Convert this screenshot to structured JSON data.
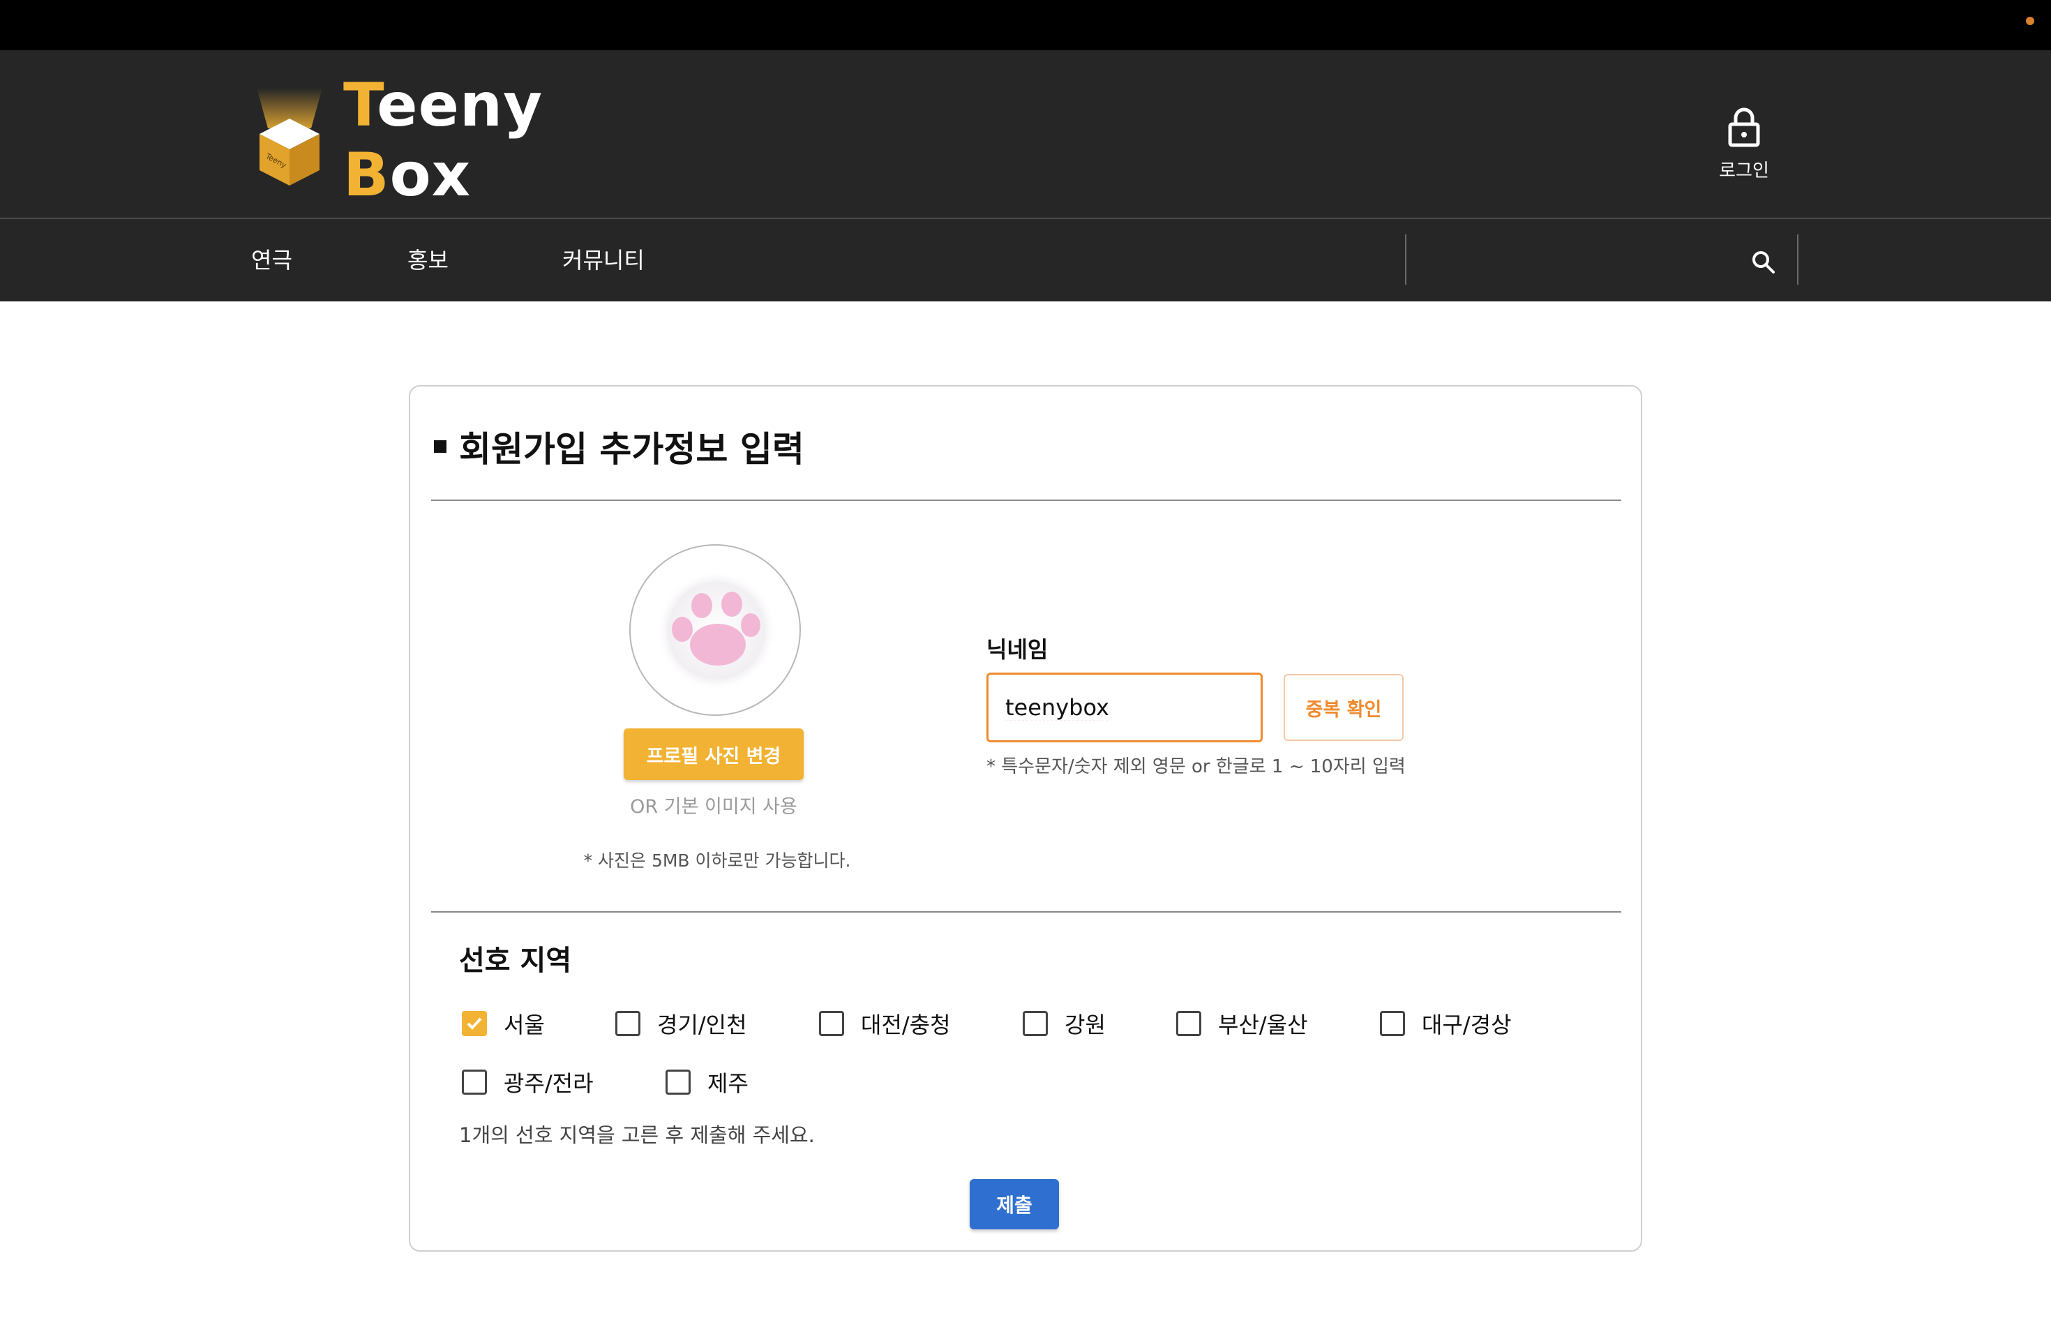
{
  "header": {
    "logo_text_first": "T",
    "logo_text_mid": "eeny ",
    "logo_text_b": "B",
    "logo_text_end": "ox",
    "logo_box_lettering": "Teeny",
    "login_label": "로그인",
    "login_icon": "lock-icon"
  },
  "nav": {
    "items": [
      {
        "label": "연극"
      },
      {
        "label": "홍보"
      },
      {
        "label": "커뮤니티"
      }
    ],
    "search_icon": "search-icon"
  },
  "form": {
    "title": "회원가입 추가정보 입력",
    "profile": {
      "change_button": "프로필 사진 변경",
      "default_option": "OR 기본 이미지 사용",
      "note": "* 사진은 5MB 이하로만 가능합니다."
    },
    "nickname": {
      "label": "닉네임",
      "value": "teenybox",
      "check_button": "중복 확인",
      "note": "* 특수문자/숫자 제외 영문 or 한글로 1 ~ 10자리 입력"
    },
    "region": {
      "title": "선호 지역",
      "options": [
        {
          "label": "서울",
          "checked": true
        },
        {
          "label": "경기/인천",
          "checked": false
        },
        {
          "label": "대전/충청",
          "checked": false
        },
        {
          "label": "강원",
          "checked": false
        },
        {
          "label": "부산/울산",
          "checked": false
        },
        {
          "label": "대구/경상",
          "checked": false
        },
        {
          "label": "광주/전라",
          "checked": false
        },
        {
          "label": "제주",
          "checked": false
        }
      ],
      "note": "1개의 선호 지역을 고른 후 제출해 주세요."
    },
    "submit": "제출"
  },
  "colors": {
    "accent": "#f2b233",
    "orange": "#f08a2e",
    "primary": "#2f6fcf",
    "header_bg": "#262626"
  }
}
